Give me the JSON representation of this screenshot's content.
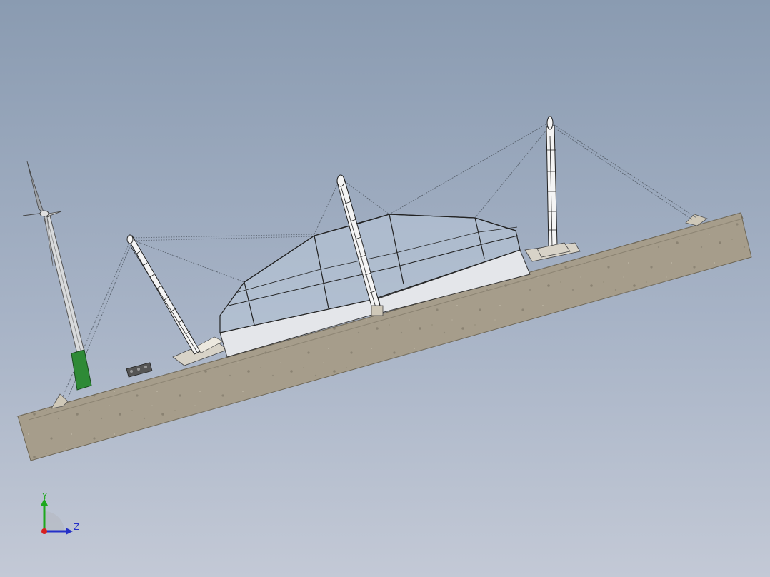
{
  "viewport": {
    "background_top": "#8a9bb1",
    "background_bottom": "#c3c9d6"
  },
  "model": {
    "ground_color": "#a69d8b",
    "ground_edge_color": "#8b8372",
    "membrane_color": "#dfe5ee",
    "glass_color": "#bdcad9",
    "mast_color": "#e9e9e9",
    "pole_base_color": "#2e8a36"
  },
  "triad": {
    "y_label": "Y",
    "z_label": "Z",
    "y_color": "#1da81d",
    "z_color": "#2430c8",
    "origin_color": "#d82020"
  }
}
